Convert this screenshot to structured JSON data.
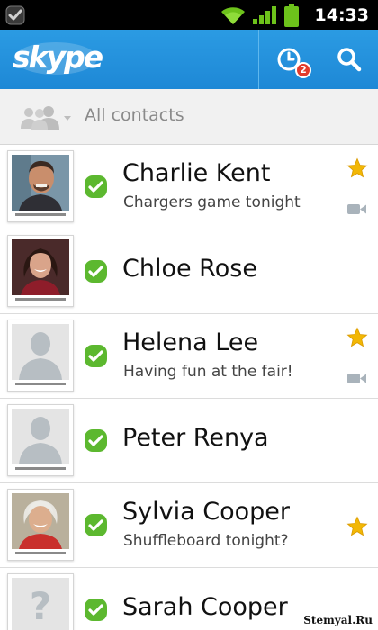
{
  "status_bar": {
    "time": "14:33",
    "icons": [
      "notification-check-icon",
      "wifi-icon",
      "signal-icon",
      "battery-icon"
    ]
  },
  "app_bar": {
    "logo": "skype",
    "recent_badge_count": "2",
    "buttons": [
      "recent-activity-icon",
      "search-icon"
    ],
    "accent_color": "#1e88d6"
  },
  "filter": {
    "label": "All contacts",
    "icon": "contacts-group-icon"
  },
  "contacts": [
    {
      "name": "Charlie Kent",
      "status": "Chargers game tonight",
      "favorite": true,
      "video": true,
      "avatar": "photo-man"
    },
    {
      "name": "Chloe Rose",
      "status": "",
      "favorite": false,
      "video": false,
      "avatar": "photo-woman"
    },
    {
      "name": "Helena Lee",
      "status": "Having fun at the fair!",
      "favorite": true,
      "video": true,
      "avatar": "placeholder-person"
    },
    {
      "name": "Peter Renya",
      "status": "",
      "favorite": false,
      "video": false,
      "avatar": "placeholder-person"
    },
    {
      "name": "Sylvia Cooper",
      "status": "Shuffleboard tonight?",
      "favorite": true,
      "video": false,
      "avatar": "photo-older-woman"
    },
    {
      "name": "Sarah Cooper",
      "status": "",
      "favorite": false,
      "video": false,
      "avatar": "placeholder-unknown"
    }
  ],
  "colors": {
    "presence_online": "#5cb82f",
    "favorite_star": "#f2b705",
    "status_bar": "#000000"
  },
  "watermark": "Stemyal.Ru"
}
